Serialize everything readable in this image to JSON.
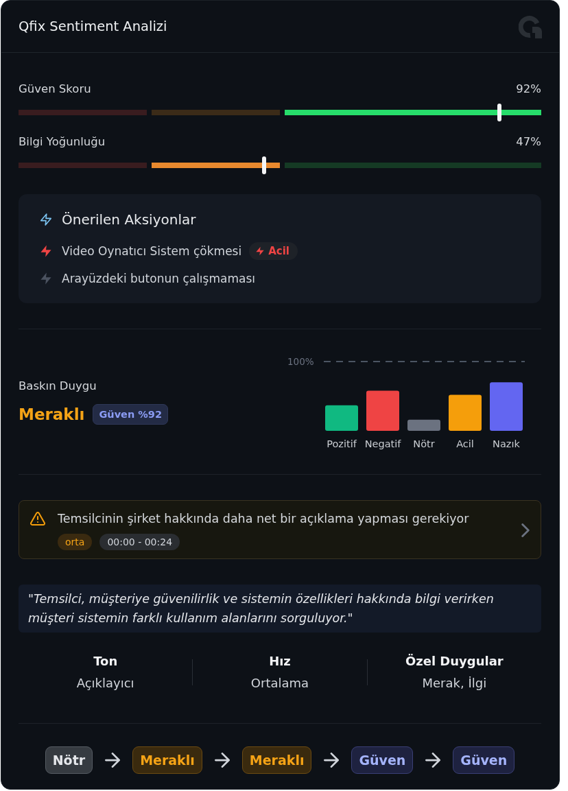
{
  "header": {
    "title": "Qfix Sentiment Analizi"
  },
  "meters": [
    {
      "label": "Güven Skoru",
      "reading": "92%",
      "level": 0.92
    },
    {
      "label": "Bilgi Yoğunluğu",
      "reading": "47%",
      "level": 0.47
    }
  ],
  "actions": {
    "title": "Önerilen Aksiyonlar",
    "items": [
      {
        "text": "Video Oynatıcı Sistem çökmesi",
        "urgent": true,
        "badge": "Acil"
      },
      {
        "text": "Arayüzdeki butonun çalışmaması",
        "urgent": false
      }
    ]
  },
  "dominant_emotion": {
    "label": "Baskın Duygu",
    "value": "Meraklı",
    "badge": "Güven %92"
  },
  "emotion_chart": {
    "scale_label": "100%",
    "bars": [
      {
        "label": "Pozitif",
        "color": "#10b981"
      },
      {
        "label": "Negatif",
        "color": "#ef4444"
      },
      {
        "label": "Nötr",
        "color": "#6b7280"
      },
      {
        "label": "Acil",
        "color": "#f59e0b"
      },
      {
        "label": "Nazık",
        "color": "#6366f1"
      }
    ]
  },
  "alert": {
    "text": "Temsilcinin şirket hakkında daha net bir açıklama yapması gerekiyor",
    "severity": "orta",
    "time_range": "00:00 - 00:24"
  },
  "summary": "\"Temsilci, müşteriye güvenilirlik ve sistemin özellikleri hakkında bilgi verirken müşteri sistemin farklı kullanım alanlarını sorguluyor.\"",
  "stats": [
    {
      "title": "Ton",
      "value": "Açıklayıcı"
    },
    {
      "title": "Hız",
      "value": "Ortalama"
    },
    {
      "title": "Özel Duygular",
      "value": "Merak, İlgi"
    }
  ],
  "flow": [
    {
      "label": "Nötr",
      "kind": "neutral"
    },
    {
      "label": "Meraklı",
      "kind": "curious"
    },
    {
      "label": "Meraklı",
      "kind": "curious"
    },
    {
      "label": "Güven",
      "kind": "trust"
    },
    {
      "label": "Güven",
      "kind": "trust"
    }
  ]
}
